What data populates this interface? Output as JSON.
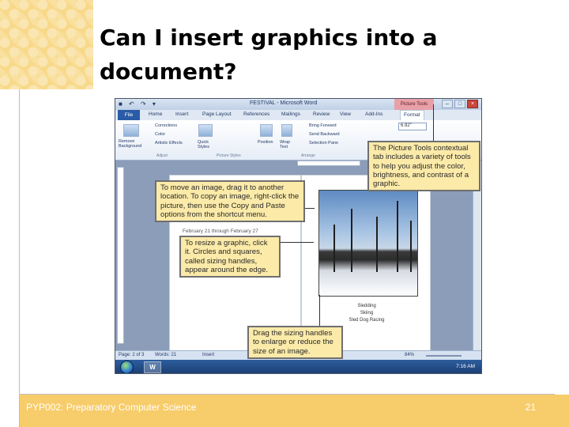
{
  "slide": {
    "title": "Can I insert graphics into a document?",
    "course": "PYP002: Preparatory Computer Science",
    "page_number": "21",
    "accent_color": "#f7cc6a"
  },
  "word_window": {
    "title": "FESTIVAL - Microsoft Word",
    "contextual_tab": "Picture Tools",
    "tabs": [
      "File",
      "Home",
      "Insert",
      "Page Layout",
      "References",
      "Mailings",
      "Review",
      "View",
      "Add-Ins",
      "Format"
    ],
    "ribbon": {
      "remove_background": "Remove Background",
      "corrections": "Corrections",
      "color": "Color",
      "artistic_effects": "Artistic Effects",
      "quick_styles": "Quick Styles",
      "position": "Position",
      "wrap_text": "Wrap Text",
      "bring_forward": "Bring Forward",
      "send_backward": "Send Backward",
      "selection_pane": "Selection Pane",
      "groups": [
        "Adjust",
        "Picture Styles",
        "Arrange"
      ],
      "size_value": "6.92\""
    },
    "document": {
      "date_text": "February 21 through February 27",
      "captions": [
        "Sledding",
        "Skiing",
        "Sled Dog Racing"
      ]
    },
    "status": {
      "page": "Page: 2 of 3",
      "words": "Words: 21",
      "mode": "Insert",
      "zoom": "84%"
    },
    "taskbar": {
      "app_label": "W",
      "clock": "7:16 AM"
    }
  },
  "callouts": {
    "picture_tools": "The Picture Tools contextual tab includes a variety of tools to help you adjust the color, brightness, and contrast of a graphic.",
    "move_image": "To move an image, drag it to another location. To copy an image, right-click the picture, then use the Copy and Paste options from the shortcut menu.",
    "resize": "To resize a graphic, click it. Circles and squares, called sizing handles, appear around the edge.",
    "sizing_handles": "Drag the sizing handles to enlarge or reduce the size of an image."
  }
}
